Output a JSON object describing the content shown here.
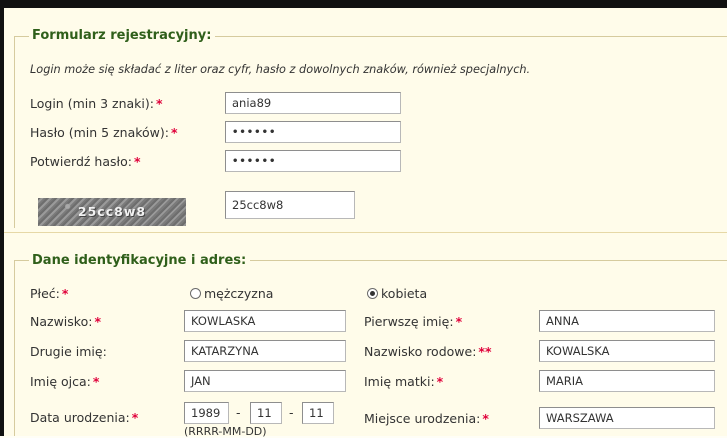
{
  "registration": {
    "legend": "Formularz rejestracyjny:",
    "hint": "Login może się składać z liter oraz cyfr, hasło z dowolnych znaków, również specjalnych.",
    "login_label": "Login (min 3 znaki):",
    "login_value": "ania89",
    "password_label": "Hasło (min 5 znaków):",
    "password_value": "••••••",
    "confirm_label": "Potwierdź hasło:",
    "confirm_value": "••••••",
    "captcha_text": "25cc8w8",
    "captcha_value": "25cc8w8",
    "required_mark": "*"
  },
  "identity": {
    "legend": "Dane identyfikacyjne i adres:",
    "gender_label": "Płeć:",
    "gender_options": [
      "mężczyzna",
      "kobieta"
    ],
    "gender_selected": "kobieta",
    "surname_label": "Nazwisko:",
    "surname_value": "KOWLASKA",
    "first_name_label": "Pierwszę imię:",
    "first_name_value": "ANNA",
    "second_name_label": "Drugie imię:",
    "second_name_value": "KATARZYNA",
    "maiden_name_label": "Nazwisko rodowe:",
    "maiden_name_mark": "**",
    "maiden_name_value": "KOWALSKA",
    "father_label": "Imię ojca:",
    "father_value": "JAN",
    "mother_label": "Imię matki:",
    "mother_value": "MARIA",
    "birth_date_label": "Data urodzenia:",
    "birth_year": "1989",
    "birth_month": "11",
    "birth_day": "11",
    "date_sep": "-",
    "date_format": "(RRRR-MM-DD)",
    "birthplace_label": "Miejsce urodzenia:",
    "birthplace_value": "WARSZAWA"
  },
  "colors": {
    "legend": "#2f5f1a",
    "required": "#e0003a",
    "background": "#fffcea"
  }
}
